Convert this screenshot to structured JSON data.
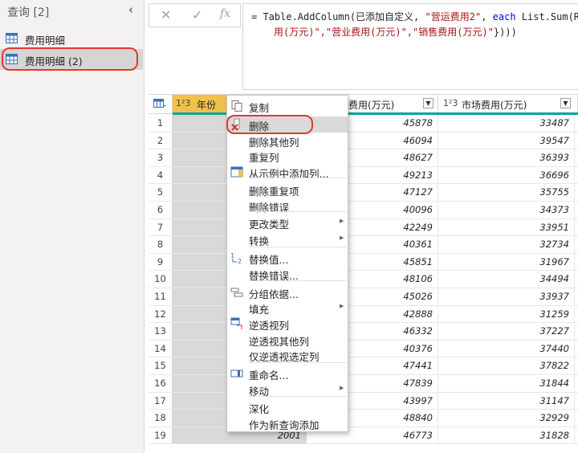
{
  "queries_pane": {
    "title": "查询 [2]",
    "collapse_icon": "chevron-left-icon",
    "items": [
      {
        "label": "费用明细",
        "icon": "table-icon"
      },
      {
        "label": "费用明细 (2)",
        "icon": "table-icon",
        "selected": true
      }
    ]
  },
  "formula_bar": {
    "cancel_icon": "✕",
    "commit_icon": "✓",
    "fx_label": "fx",
    "line1_a": "= Table.AddColumn(已添加自定义, ",
    "line1_str": "\"营运费用2\"",
    "line1_b": ", ",
    "line1_kw": "each",
    "line1_c": " List.Sum(Rec",
    "line2_str": "用(万元)\",\"营业费用(万元)\",\"销售费用(万元)\"",
    "line2_c": "})))"
  },
  "grid": {
    "columns": [
      {
        "type": "1²3",
        "label": "年份"
      },
      {
        "label": "费用(万元)"
      },
      {
        "type": "1²3",
        "label": "市场费用(万元)"
      }
    ],
    "rows": [
      {
        "n": "1",
        "c2": "45878",
        "c3": "33487"
      },
      {
        "n": "2",
        "c2": "46094",
        "c3": "39547"
      },
      {
        "n": "3",
        "c2": "48627",
        "c3": "36393"
      },
      {
        "n": "4",
        "c2": "49213",
        "c3": "36696"
      },
      {
        "n": "5",
        "c2": "47127",
        "c3": "35755"
      },
      {
        "n": "6",
        "c2": "40096",
        "c3": "34373"
      },
      {
        "n": "7",
        "c2": "42249",
        "c3": "33951"
      },
      {
        "n": "8",
        "c2": "40361",
        "c3": "32734"
      },
      {
        "n": "9",
        "c2": "45851",
        "c3": "31967"
      },
      {
        "n": "10",
        "c2": "48106",
        "c3": "34494"
      },
      {
        "n": "11",
        "c2": "45026",
        "c3": "33937"
      },
      {
        "n": "12",
        "c2": "42888",
        "c3": "31259"
      },
      {
        "n": "13",
        "c2": "46332",
        "c3": "37227"
      },
      {
        "n": "14",
        "c2": "40376",
        "c3": "37440"
      },
      {
        "n": "15",
        "c2": "47441",
        "c3": "37822"
      },
      {
        "n": "16",
        "c2": "47839",
        "c3": "31844"
      },
      {
        "n": "17",
        "c2": "43997",
        "c3": "31147"
      },
      {
        "n": "18",
        "c2": "48840",
        "c3": "32929"
      },
      {
        "n": "19",
        "year": "2001",
        "c2": "46773",
        "c3": "31828"
      }
    ]
  },
  "context_menu": {
    "items": [
      {
        "label": "复制",
        "icon": "copy-icon"
      },
      {
        "label": "删除",
        "icon": "delete-column-icon",
        "highlight": true
      },
      {
        "label": "删除其他列"
      },
      {
        "label": "重复列"
      },
      {
        "label": "从示例中添加列...",
        "icon": "column-from-examples-icon"
      },
      {
        "label": "删除重复项"
      },
      {
        "label": "删除错误"
      },
      {
        "label": "更改类型",
        "submenu": true
      },
      {
        "label": "转换",
        "submenu": true
      },
      {
        "label": "替换值...",
        "icon": "replace-values-icon"
      },
      {
        "label": "替换错误..."
      },
      {
        "label": "分组依据...",
        "icon": "group-by-icon"
      },
      {
        "label": "填充",
        "submenu": true
      },
      {
        "label": "逆透视列",
        "icon": "unpivot-icon"
      },
      {
        "label": "逆透视其他列"
      },
      {
        "label": "仅逆透视选定列"
      },
      {
        "label": "重命名...",
        "icon": "rename-icon"
      },
      {
        "label": "移动",
        "submenu": true
      },
      {
        "label": "深化"
      },
      {
        "label": "作为新查询添加"
      }
    ]
  },
  "colors": {
    "accent_teal": "#00a4a0",
    "highlight_red": "#e0392d",
    "header_yellow": "#f0c24b"
  }
}
